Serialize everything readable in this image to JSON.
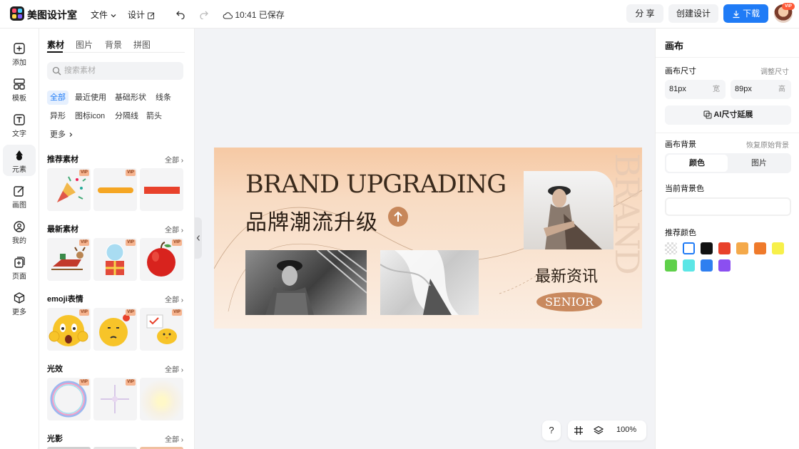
{
  "topbar": {
    "app_name": "美图设计室",
    "menu_file": "文件",
    "menu_design": "设计",
    "save_status": "10:41 已保存",
    "share_label": "分 享",
    "create_label": "创建设计",
    "download_label": "下载",
    "vip_badge": "VIP"
  },
  "leftbar": {
    "items": [
      {
        "label": "添加",
        "icon": "plus-square-icon"
      },
      {
        "label": "模板",
        "icon": "template-icon"
      },
      {
        "label": "文字",
        "icon": "text-icon"
      },
      {
        "label": "元素",
        "icon": "shapes-icon"
      },
      {
        "label": "画图",
        "icon": "draw-icon"
      },
      {
        "label": "我的",
        "icon": "user-icon"
      },
      {
        "label": "页面",
        "icon": "page-icon"
      },
      {
        "label": "更多",
        "icon": "cube-icon"
      }
    ],
    "active_index": 3
  },
  "panel": {
    "tabs": [
      "素材",
      "图片",
      "背景",
      "拼图"
    ],
    "search_placeholder": "搜索素材",
    "chips": [
      "全部",
      "最近使用",
      "基础形状",
      "线条",
      "异形",
      "图标icon",
      "分隔线",
      "箭头",
      "更多"
    ],
    "sections": [
      {
        "title": "推荐素材",
        "all": "全部"
      },
      {
        "title": "最新素材",
        "all": "全部"
      },
      {
        "title": "emoji表情",
        "all": "全部"
      },
      {
        "title": "光效",
        "all": "全部"
      },
      {
        "title": "光影",
        "all": "全部"
      }
    ],
    "vip_tag": "VIP"
  },
  "banner": {
    "title_en": "BRAND UPGRADING",
    "title_cn": "品牌潮流升级",
    "news": "最新资讯",
    "senior": "SENIOR",
    "vertical": "BRAND"
  },
  "zoom": {
    "help": "?",
    "level": "100%"
  },
  "right": {
    "title": "画布",
    "size_label": "画布尺寸",
    "adjust_link": "调整尺寸",
    "width_value": "81px",
    "width_unit": "宽",
    "height_value": "89px",
    "height_unit": "高",
    "ai_button": "AI尺寸延展",
    "bg_label": "画布背景",
    "restore_link": "恢复原始背景",
    "seg_color": "颜色",
    "seg_image": "图片",
    "current_bg_label": "当前背景色",
    "recommend_label": "推荐颜色",
    "swatches": [
      "transparent",
      "#ffffff",
      "#111111",
      "#e8412b",
      "#f4a94a",
      "#ef7a2b",
      "#f7f04a",
      "#5fd04a",
      "#5ce6e6",
      "#2f7ff0",
      "#8b4ff0"
    ]
  }
}
